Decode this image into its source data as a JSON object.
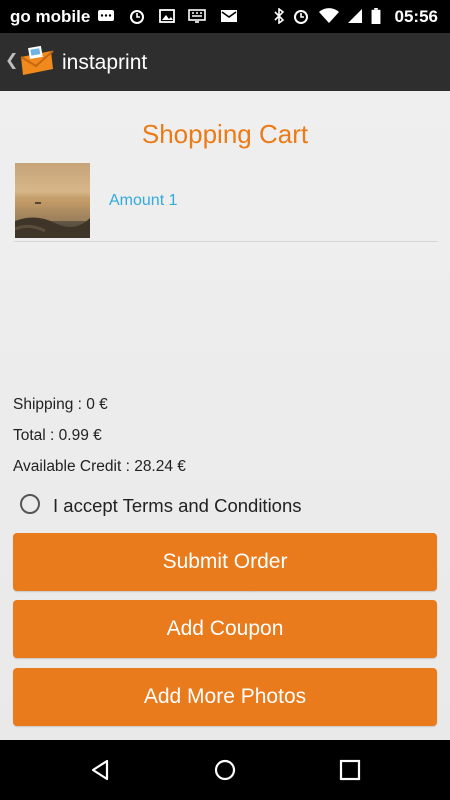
{
  "status_bar": {
    "carrier": "go mobile",
    "time": "05:56",
    "icons": [
      "chat-icon",
      "alarm-icon",
      "image-icon",
      "keyboard-icon",
      "mail-icon",
      "bluetooth-icon",
      "alarm-icon",
      "wifi-icon",
      "signal-icon",
      "battery-icon"
    ]
  },
  "app_bar": {
    "title": "instaprint",
    "icons": [
      "back-chevron-icon",
      "app-logo-icon"
    ]
  },
  "page": {
    "heading": "Shopping Cart",
    "cart_items": [
      {
        "amount_label": "Amount 1",
        "thumbnail": "beach-photo-thumbnail"
      }
    ],
    "shipping": "Shipping : 0 €",
    "total": "Total : 0.99 €",
    "available_credit": "Available Credit : 28.24 €",
    "terms_label": "I accept Terms and Conditions",
    "terms_checked": false,
    "buttons": {
      "submit": "Submit Order",
      "coupon": "Add Coupon",
      "more_photos": "Add More Photos"
    }
  },
  "nav_bar": {
    "icons": [
      "back-triangle-icon",
      "home-circle-icon",
      "recents-square-icon"
    ]
  },
  "colors": {
    "accent": "#ea7b1c",
    "link": "#33aadd",
    "action_bar": "#2e2e2e"
  }
}
